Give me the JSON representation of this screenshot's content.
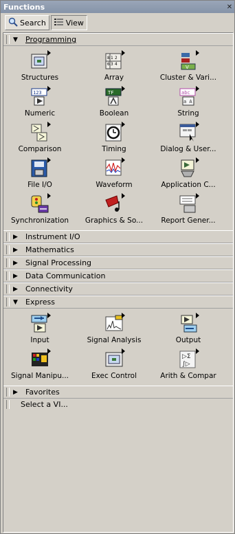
{
  "window": {
    "title": "Functions"
  },
  "toolbar": {
    "search_label": "Search",
    "view_label": "View"
  },
  "palette": {
    "programming": {
      "label": "Programming",
      "items": [
        {
          "label": "Structures",
          "icon": "structures-icon"
        },
        {
          "label": "Array",
          "icon": "array-icon"
        },
        {
          "label": "Cluster & Vari...",
          "icon": "cluster-icon"
        },
        {
          "label": "Numeric",
          "icon": "numeric-icon"
        },
        {
          "label": "Boolean",
          "icon": "boolean-icon"
        },
        {
          "label": "String",
          "icon": "string-icon"
        },
        {
          "label": "Comparison",
          "icon": "comparison-icon"
        },
        {
          "label": "Timing",
          "icon": "timing-icon"
        },
        {
          "label": "Dialog & User...",
          "icon": "dialog-icon"
        },
        {
          "label": "File I/O",
          "icon": "file-io-icon"
        },
        {
          "label": "Waveform",
          "icon": "waveform-icon"
        },
        {
          "label": "Application C...",
          "icon": "app-control-icon"
        },
        {
          "label": "Synchronization",
          "icon": "synchronization-icon"
        },
        {
          "label": "Graphics & So...",
          "icon": "graphics-icon"
        },
        {
          "label": "Report Gener...",
          "icon": "report-icon"
        }
      ]
    },
    "collapsed": [
      {
        "label": "Instrument I/O"
      },
      {
        "label": "Mathematics"
      },
      {
        "label": "Signal Processing"
      },
      {
        "label": "Data Communication"
      },
      {
        "label": "Connectivity"
      }
    ],
    "express": {
      "label": "Express",
      "items": [
        {
          "label": "Input",
          "icon": "input-icon"
        },
        {
          "label": "Signal Analysis",
          "icon": "signal-analysis-icon"
        },
        {
          "label": "Output",
          "icon": "output-icon"
        },
        {
          "label": "Signal Manipu...",
          "icon": "signal-manip-icon"
        },
        {
          "label": "Exec Control",
          "icon": "exec-control-icon"
        },
        {
          "label": "Arith & Compar",
          "icon": "arith-icon"
        }
      ]
    },
    "favorites": {
      "label": "Favorites"
    },
    "select_vi": {
      "label": "Select a VI..."
    }
  }
}
